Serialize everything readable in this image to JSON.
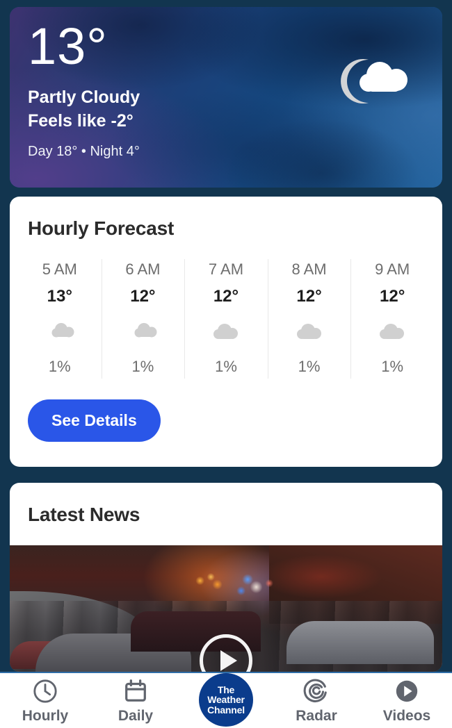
{
  "hero": {
    "temperature": "13°",
    "condition": "Partly Cloudy",
    "feels_like": "Feels like -2°",
    "day_night": "Day 18° • Night 4°",
    "icon": "moon-behind-cloud-icon"
  },
  "hourly": {
    "title": "Hourly Forecast",
    "see_details_label": "See Details",
    "accent_color": "#2a56e8",
    "columns": [
      {
        "time": "5 AM",
        "temp": "13°",
        "icon": "moon-behind-cloud-icon",
        "precip": "1%"
      },
      {
        "time": "6 AM",
        "temp": "12°",
        "icon": "moon-behind-cloud-icon",
        "precip": "1%"
      },
      {
        "time": "7 AM",
        "temp": "12°",
        "icon": "cloud-icon",
        "precip": "1%"
      },
      {
        "time": "8 AM",
        "temp": "12°",
        "icon": "cloud-icon",
        "precip": "1%"
      },
      {
        "time": "9 AM",
        "temp": "12°",
        "icon": "cloud-icon",
        "precip": "1%"
      }
    ]
  },
  "news": {
    "title": "Latest News",
    "media_icon": "play-button-icon"
  },
  "bottom_nav": {
    "items": [
      {
        "label": "Hourly",
        "icon": "clock-icon"
      },
      {
        "label": "Daily",
        "icon": "calendar-icon"
      },
      {
        "label": "",
        "icon": "the-weather-channel-logo"
      },
      {
        "label": "Radar",
        "icon": "radar-spiral-icon"
      },
      {
        "label": "Videos",
        "icon": "play-circle-icon"
      }
    ],
    "logo": {
      "line1": "The",
      "line2": "Weather",
      "line3": "Channel",
      "color": "#0b3c8c"
    }
  },
  "theme": {
    "page_background": "#12354f",
    "card_background": "#ffffff",
    "accent_blue": "#2a56e8",
    "muted_text": "#6d6d6d"
  }
}
